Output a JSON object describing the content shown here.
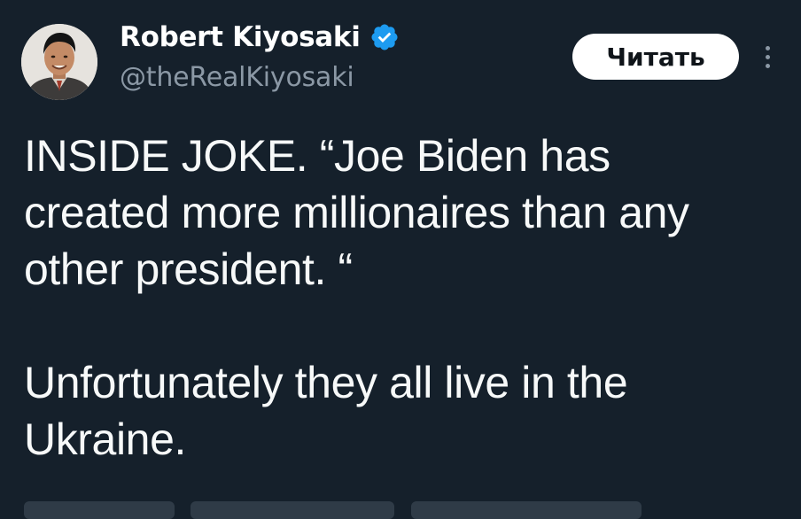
{
  "author": {
    "display_name": "Robert Kiyosaki",
    "handle": "@theRealKiyosaki",
    "verified": true,
    "avatar_icon": "profile-photo"
  },
  "actions": {
    "follow_label": "Читать",
    "more_icon": "more-vertical-icon"
  },
  "tweet": {
    "paragraph_1": "INSIDE JOKE.  “Joe Biden has\ncreated more millionaires than any\nother president. “",
    "paragraph_2": "Unfortunately they all live in the\nUkraine."
  },
  "colors": {
    "background": "#15202b",
    "text": "#f7f9f9",
    "secondary_text": "#8b98a5",
    "verified_blue": "#1d9bf0",
    "button_bg": "#ffffff"
  }
}
